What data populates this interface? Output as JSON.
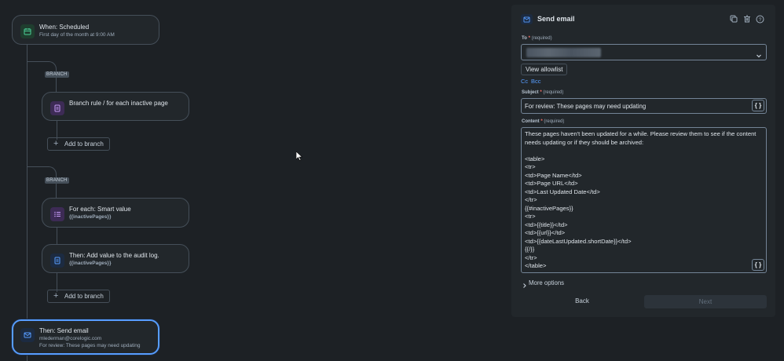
{
  "flow": {
    "trigger": {
      "title": "When: Scheduled",
      "subtitle": "First day of the month at 9:00 AM"
    },
    "branch1": {
      "badge": "BRANCH",
      "rule": {
        "title": "Branch rule / for each inactive page"
      },
      "add_label": "Add to branch"
    },
    "branch2": {
      "badge": "BRANCH",
      "foreach": {
        "title": "For each: Smart value",
        "subtitle": "{{inactivePages}}"
      },
      "audit": {
        "title": "Then: Add value to the audit log.",
        "subtitle": "{{inactivePages}}"
      },
      "add_label": "Add to branch"
    },
    "email_node": {
      "title": "Then: Send email",
      "line1": "mlederman@corelogic.com",
      "line2": "For review: These pages may need updating"
    }
  },
  "panel": {
    "title": "Send email",
    "to": {
      "label": "To",
      "required_text": "(required)"
    },
    "view_allowlist": "View allowlist",
    "cc": "Cc",
    "bcc": "Bcc",
    "subject": {
      "label": "Subject",
      "required_text": "(required)",
      "value": "For review: These pages may need updating"
    },
    "content": {
      "label": "Content",
      "required_text": "(required)",
      "lines": [
        "These pages haven't been updated for a while. Please review them to see if the content",
        "needs updating or if they should be archived:",
        "",
        "<table>",
        "<tr>",
        "<td>Page Name</td>",
        "<td>Page URL</td>",
        "<td>Last Updated Date</td>",
        "</tr>",
        "{{#inactivePages}}",
        "<tr>",
        "<td>{{title}}</td>",
        "<td>{{url}}</td>",
        "<td>{{dateLastUpdated.shortDate}}</td>",
        "{{/}}",
        "</tr>",
        "</table>"
      ]
    },
    "brace_label": "{ }",
    "more_options": "More options",
    "back": "Back",
    "next": "Next"
  },
  "colors": {
    "accent": "#579dff",
    "required": "#f87168",
    "panel_bg": "#22272b",
    "canvas_bg": "#1d2125"
  }
}
